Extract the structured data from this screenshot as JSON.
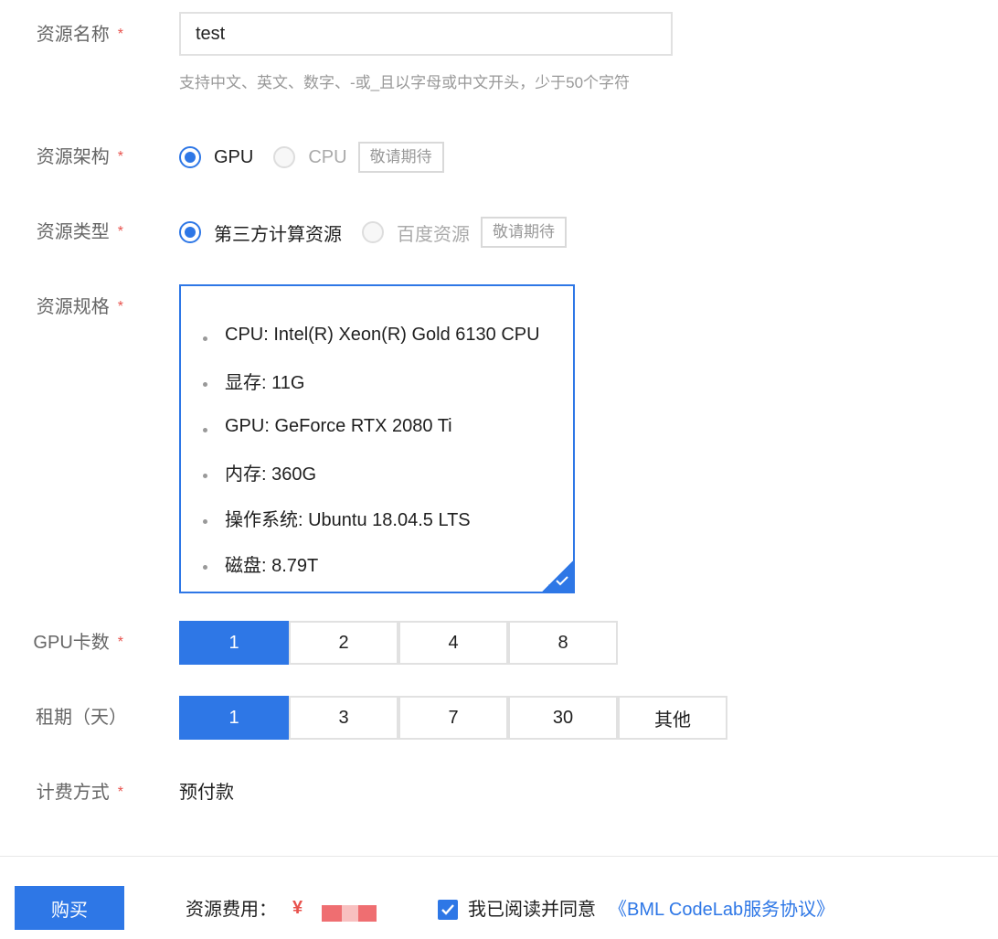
{
  "form": {
    "name": {
      "label": "资源名称",
      "required_mark": "*",
      "value": "test",
      "hint": "支持中文、英文、数字、-或_且以字母或中文开头，少于50个字符"
    },
    "architecture": {
      "label": "资源架构",
      "required_mark": "*",
      "options": [
        {
          "label": "GPU",
          "selected": true,
          "disabled": false
        },
        {
          "label": "CPU",
          "selected": false,
          "disabled": true
        }
      ],
      "coming_soon": "敬请期待"
    },
    "type": {
      "label": "资源类型",
      "required_mark": "*",
      "options": [
        {
          "label": "第三方计算资源",
          "selected": true,
          "disabled": false
        },
        {
          "label": "百度资源",
          "selected": false,
          "disabled": true
        }
      ],
      "coming_soon": "敬请期待"
    },
    "spec": {
      "label": "资源规格",
      "required_mark": "*",
      "selected": true,
      "items": [
        "CPU: Intel(R) Xeon(R) Gold 6130 CPU",
        "显存: 11G",
        "GPU: GeForce RTX 2080 Ti",
        "内存: 360G",
        "操作系统: Ubuntu 18.04.5 LTS",
        "磁盘: 8.79T"
      ]
    },
    "gpu_count": {
      "label": "GPU卡数",
      "required_mark": "*",
      "options": [
        "1",
        "2",
        "4",
        "8"
      ],
      "selected": "1"
    },
    "lease": {
      "label": "租期（天）",
      "options": [
        "1",
        "3",
        "7",
        "30",
        "其他"
      ],
      "selected": "1"
    },
    "billing": {
      "label": "计费方式",
      "required_mark": "*",
      "value": "预付款"
    }
  },
  "footer": {
    "buy_label": "购买",
    "fee_label": "资源费用：",
    "fee_currency": "¥",
    "agree_checked": true,
    "agree_text": "我已阅读并同意",
    "agreement_link": "《BML CodeLab服务协议》"
  },
  "colors": {
    "primary": "#2e77e6",
    "required": "#e8524d",
    "redact_dark": "#ef6e71",
    "redact_light": "#f8c0c0"
  }
}
